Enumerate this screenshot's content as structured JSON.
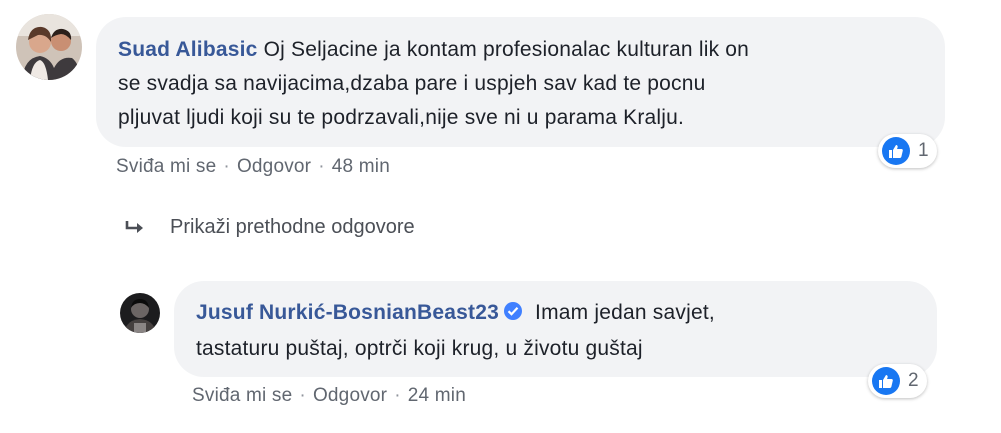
{
  "comment": {
    "author": "Suad Alibasic",
    "line1": "Oj Seljacine ja kontam profesionalac kulturan lik on",
    "line2": "se svadja sa navijacima,dzaba pare i uspjeh sav kad te pocnu",
    "line3": "pljuvat ljudi koji su te podrzavali,nije sve ni u parama Kralju.",
    "like_label": "Sviđa mi se",
    "reply_label": "Odgovor",
    "time": "48 min",
    "reaction_count": "1"
  },
  "view_previous": {
    "label": "Prikaži prethodne odgovore"
  },
  "reply": {
    "author": "Jusuf Nurkić-BosnianBeast23",
    "line1": "Imam jedan savjet,",
    "line2": "tastaturu puštaj, optrči koji krug, u životu guštaj",
    "like_label": "Sviđa mi se",
    "reply_label": "Odgovor",
    "time": "24 min",
    "reaction_count": "2"
  },
  "colors": {
    "author": "#385898",
    "bubble": "#f2f3f5",
    "like": "#1877f2",
    "meta": "#616770"
  }
}
